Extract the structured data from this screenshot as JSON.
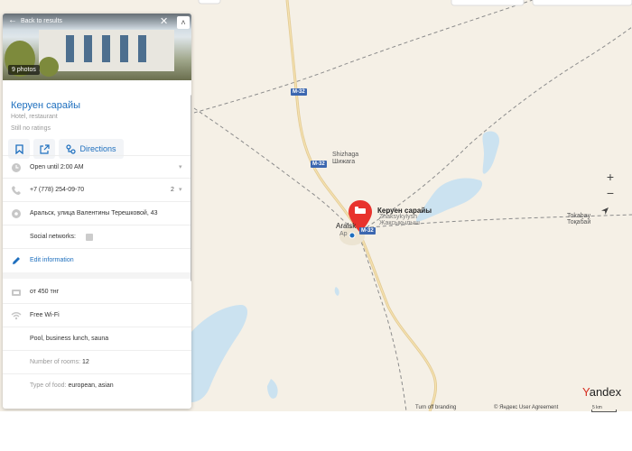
{
  "panel": {
    "back_label": "Back to results",
    "photos_label": "9 photos",
    "title": "Керуен сарайы",
    "category": "Hotel, restaurant",
    "ratings": "Still no ratings",
    "directions_label": "Directions",
    "hours": "Open until 2:00 AM",
    "phone": "+7 (778) 254-09-70",
    "phone_count": "2",
    "address": "Аральск, улица Валентины Терешковой, 43",
    "social_label": "Social networks:",
    "edit_label": "Edit information",
    "price": "от 450 тнг",
    "wifi": "Free Wi-Fi",
    "features": "Pool, business lunch, sauna",
    "rooms_label": "Number of rooms:",
    "rooms_value": "12",
    "food_label": "Type of food:",
    "food_value": "european, asian"
  },
  "map": {
    "pin_label": "Керуен сарайы",
    "labels": {
      "shizhaga_en": "Shizhaga",
      "shizhaga_kz": "Шижага",
      "zhaksykylysh_en": "Zhaksykylysh",
      "zhaksykylysh_kz": "Жақсықылыш",
      "tokabay_en": "Tokabay",
      "tokabay_kz": "Тоқабай",
      "aralsk": "Aralsk",
      "aralsk_sub": "Ар"
    },
    "road_badges": [
      "M-32",
      "M-32",
      "M-32"
    ],
    "zoom_in": "+",
    "zoom_out": "−"
  },
  "footer": {
    "turn_off_branding": "Turn off branding",
    "copyright": "© Яндекс User Agreement",
    "logo_first": "Y",
    "logo_rest": "andex",
    "scale": "5 km"
  },
  "colors": {
    "water": "#cbe2f0",
    "land": "#f5f0e6",
    "road_main": "#e3cb95",
    "pin": "#e8332d",
    "link": "#1e6fbe"
  }
}
